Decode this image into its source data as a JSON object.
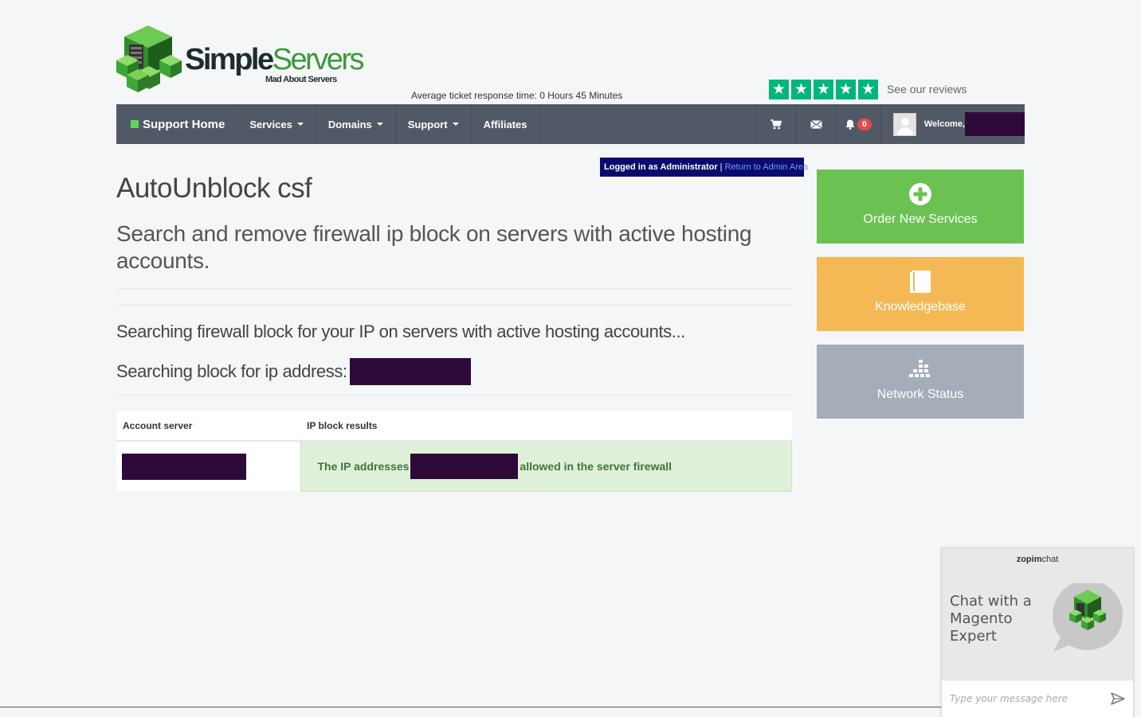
{
  "header": {
    "logo_word1": "Simple",
    "logo_word2": "Servers",
    "logo_tagline": "Mad About Servers",
    "response_time": "Average ticket response time: 0 Hours 45 Minutes",
    "reviews_link": "See our reviews",
    "rating_stars": 5
  },
  "nav": {
    "home": "Support Home",
    "services": "Services",
    "domains": "Domains",
    "support": "Support",
    "affiliates": "Affiliates",
    "notification_count": "0",
    "welcome": "Welcome,"
  },
  "admin_bar": {
    "logged_in": "Logged in as Administrator",
    "separator": "|",
    "return_link": "Return to Admin Area"
  },
  "main": {
    "title": "AutoUnblock csf",
    "subtitle": "Search and remove firewall ip block on servers with active hosting accounts.",
    "searching": "Searching firewall block for your IP on servers with active hosting accounts...",
    "searching_ip_label": "Searching block for ip address:",
    "table": {
      "headers": [
        "Account server",
        "IP block results"
      ],
      "result_prefix": "The IP addresses",
      "result_suffix": "allowed in the server firewall"
    }
  },
  "sidebar": {
    "order": "Order New Services",
    "kb": "Knowledgebase",
    "status": "Network Status"
  },
  "chat": {
    "brand_bold": "zopim",
    "brand_rest": "chat",
    "message": "Chat with a Magento Expert",
    "placeholder": "Type your message here"
  },
  "colors": {
    "nav_bg": "#525966",
    "green": "#6cc153",
    "yellow": "#f4b955",
    "grey": "#a5adb9",
    "trustpilot": "#00b67a",
    "admin_bar": "#0b0b6e",
    "redaction": "#2e0a3a"
  }
}
